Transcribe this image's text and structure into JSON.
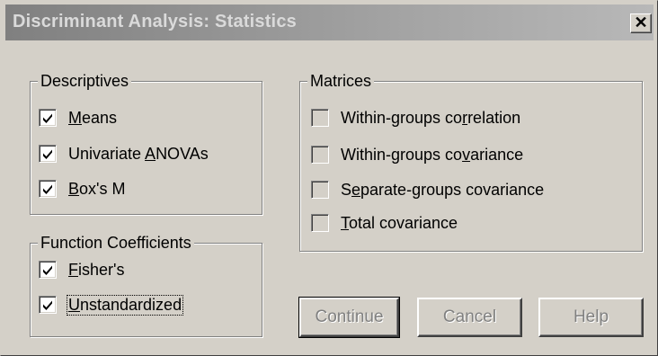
{
  "window": {
    "title": "Discriminant Analysis: Statistics",
    "close_glyph": "✕"
  },
  "descriptives": {
    "legend": "Descriptives",
    "items": [
      {
        "pre": "",
        "accel": "M",
        "post": "eans",
        "checked": true
      },
      {
        "pre": "Univariate ",
        "accel": "A",
        "post": "NOVAs",
        "checked": true
      },
      {
        "pre": "",
        "accel": "B",
        "post": "ox's M",
        "checked": true
      }
    ]
  },
  "function_coefficients": {
    "legend": "Function Coefficients",
    "items": [
      {
        "pre": "",
        "accel": "F",
        "post": "isher's",
        "checked": true
      },
      {
        "pre": "",
        "accel": "U",
        "post": "nstandardized",
        "checked": true,
        "focused": true
      }
    ]
  },
  "matrices": {
    "legend": "Matrices",
    "items": [
      {
        "pre": "Within-groups co",
        "accel": "r",
        "post": "relation",
        "checked": false
      },
      {
        "pre": "Within-groups co",
        "accel": "v",
        "post": "ariance",
        "checked": false
      },
      {
        "pre": "S",
        "accel": "e",
        "post": "parate-groups covariance",
        "checked": false
      },
      {
        "pre": "",
        "accel": "T",
        "post": "otal covariance",
        "checked": false
      }
    ]
  },
  "buttons": {
    "continue": "Continue",
    "cancel": "Cancel",
    "help": "Help"
  }
}
